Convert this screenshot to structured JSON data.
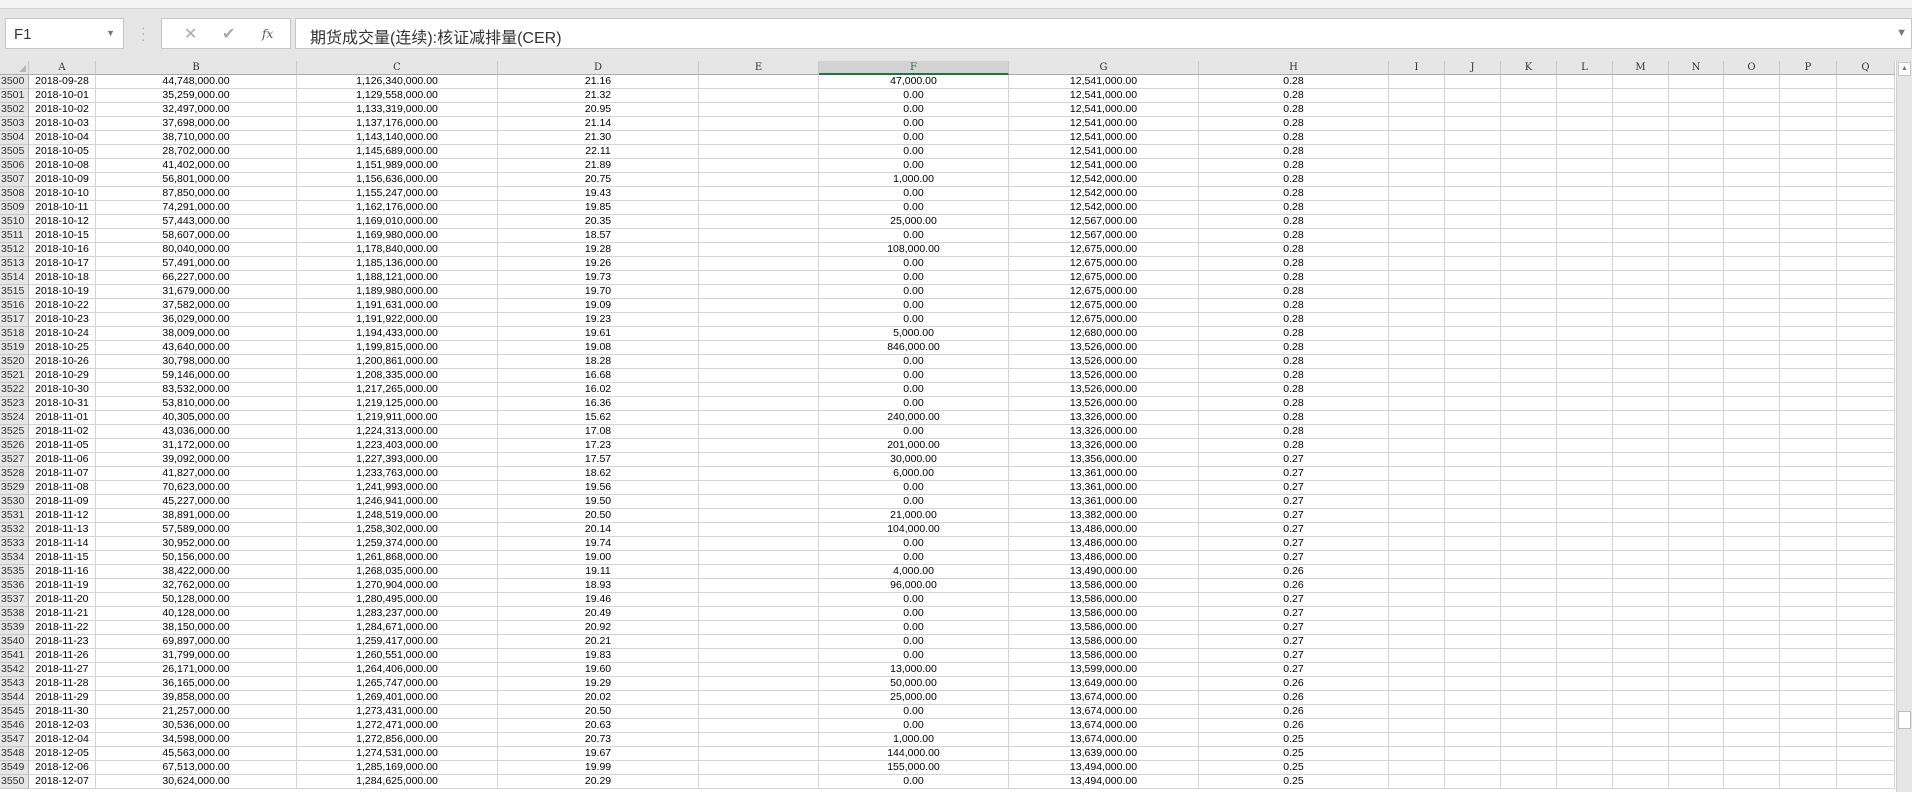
{
  "name_box": {
    "value": "F1"
  },
  "formula_bar": {
    "cancel": "✕",
    "enter": "✔",
    "fx": "fx",
    "value": "期货成交量(连续):核证减排量(CER)"
  },
  "selected_column": "F",
  "columns": [
    "A",
    "B",
    "C",
    "D",
    "E",
    "F",
    "G",
    "H",
    "I",
    "J",
    "K",
    "L",
    "M",
    "N",
    "O",
    "P",
    "Q"
  ],
  "rows": [
    [
      "3500",
      "2018-09-28",
      "44,748,000.00",
      "1,126,340,000.00",
      "21.16",
      "",
      "47,000.00",
      "12,541,000.00",
      "0.28"
    ],
    [
      "3501",
      "2018-10-01",
      "35,259,000.00",
      "1,129,558,000.00",
      "21.32",
      "",
      "0.00",
      "12,541,000.00",
      "0.28"
    ],
    [
      "3502",
      "2018-10-02",
      "32,497,000.00",
      "1,133,319,000.00",
      "20.95",
      "",
      "0.00",
      "12,541,000.00",
      "0.28"
    ],
    [
      "3503",
      "2018-10-03",
      "37,698,000.00",
      "1,137,176,000.00",
      "21.14",
      "",
      "0.00",
      "12,541,000.00",
      "0.28"
    ],
    [
      "3504",
      "2018-10-04",
      "38,710,000.00",
      "1,143,140,000.00",
      "21.30",
      "",
      "0.00",
      "12,541,000.00",
      "0.28"
    ],
    [
      "3505",
      "2018-10-05",
      "28,702,000.00",
      "1,145,689,000.00",
      "22.11",
      "",
      "0.00",
      "12,541,000.00",
      "0.28"
    ],
    [
      "3506",
      "2018-10-08",
      "41,402,000.00",
      "1,151,989,000.00",
      "21.89",
      "",
      "0.00",
      "12,541,000.00",
      "0.28"
    ],
    [
      "3507",
      "2018-10-09",
      "56,801,000.00",
      "1,156,636,000.00",
      "20.75",
      "",
      "1,000.00",
      "12,542,000.00",
      "0.28"
    ],
    [
      "3508",
      "2018-10-10",
      "87,850,000.00",
      "1,155,247,000.00",
      "19.43",
      "",
      "0.00",
      "12,542,000.00",
      "0.28"
    ],
    [
      "3509",
      "2018-10-11",
      "74,291,000.00",
      "1,162,176,000.00",
      "19.85",
      "",
      "0.00",
      "12,542,000.00",
      "0.28"
    ],
    [
      "3510",
      "2018-10-12",
      "57,443,000.00",
      "1,169,010,000.00",
      "20.35",
      "",
      "25,000.00",
      "12,567,000.00",
      "0.28"
    ],
    [
      "3511",
      "2018-10-15",
      "58,607,000.00",
      "1,169,980,000.00",
      "18.57",
      "",
      "0.00",
      "12,567,000.00",
      "0.28"
    ],
    [
      "3512",
      "2018-10-16",
      "80,040,000.00",
      "1,178,840,000.00",
      "19.28",
      "",
      "108,000.00",
      "12,675,000.00",
      "0.28"
    ],
    [
      "3513",
      "2018-10-17",
      "57,491,000.00",
      "1,185,136,000.00",
      "19.26",
      "",
      "0.00",
      "12,675,000.00",
      "0.28"
    ],
    [
      "3514",
      "2018-10-18",
      "66,227,000.00",
      "1,188,121,000.00",
      "19.73",
      "",
      "0.00",
      "12,675,000.00",
      "0.28"
    ],
    [
      "3515",
      "2018-10-19",
      "31,679,000.00",
      "1,189,980,000.00",
      "19.70",
      "",
      "0.00",
      "12,675,000.00",
      "0.28"
    ],
    [
      "3516",
      "2018-10-22",
      "37,582,000.00",
      "1,191,631,000.00",
      "19.09",
      "",
      "0.00",
      "12,675,000.00",
      "0.28"
    ],
    [
      "3517",
      "2018-10-23",
      "36,029,000.00",
      "1,191,922,000.00",
      "19.23",
      "",
      "0.00",
      "12,675,000.00",
      "0.28"
    ],
    [
      "3518",
      "2018-10-24",
      "38,009,000.00",
      "1,194,433,000.00",
      "19.61",
      "",
      "5,000.00",
      "12,680,000.00",
      "0.28"
    ],
    [
      "3519",
      "2018-10-25",
      "43,640,000.00",
      "1,199,815,000.00",
      "19.08",
      "",
      "846,000.00",
      "13,526,000.00",
      "0.28"
    ],
    [
      "3520",
      "2018-10-26",
      "30,798,000.00",
      "1,200,861,000.00",
      "18.28",
      "",
      "0.00",
      "13,526,000.00",
      "0.28"
    ],
    [
      "3521",
      "2018-10-29",
      "59,146,000.00",
      "1,208,335,000.00",
      "16.68",
      "",
      "0.00",
      "13,526,000.00",
      "0.28"
    ],
    [
      "3522",
      "2018-10-30",
      "83,532,000.00",
      "1,217,265,000.00",
      "16.02",
      "",
      "0.00",
      "13,526,000.00",
      "0.28"
    ],
    [
      "3523",
      "2018-10-31",
      "53,810,000.00",
      "1,219,125,000.00",
      "16.36",
      "",
      "0.00",
      "13,526,000.00",
      "0.28"
    ],
    [
      "3524",
      "2018-11-01",
      "40,305,000.00",
      "1,219,911,000.00",
      "15.62",
      "",
      "240,000.00",
      "13,326,000.00",
      "0.28"
    ],
    [
      "3525",
      "2018-11-02",
      "43,036,000.00",
      "1,224,313,000.00",
      "17.08",
      "",
      "0.00",
      "13,326,000.00",
      "0.28"
    ],
    [
      "3526",
      "2018-11-05",
      "31,172,000.00",
      "1,223,403,000.00",
      "17.23",
      "",
      "201,000.00",
      "13,326,000.00",
      "0.28"
    ],
    [
      "3527",
      "2018-11-06",
      "39,092,000.00",
      "1,227,393,000.00",
      "17.57",
      "",
      "30,000.00",
      "13,356,000.00",
      "0.27"
    ],
    [
      "3528",
      "2018-11-07",
      "41,827,000.00",
      "1,233,763,000.00",
      "18.62",
      "",
      "6,000.00",
      "13,361,000.00",
      "0.27"
    ],
    [
      "3529",
      "2018-11-08",
      "70,623,000.00",
      "1,241,993,000.00",
      "19.56",
      "",
      "0.00",
      "13,361,000.00",
      "0.27"
    ],
    [
      "3530",
      "2018-11-09",
      "45,227,000.00",
      "1,246,941,000.00",
      "19.50",
      "",
      "0.00",
      "13,361,000.00",
      "0.27"
    ],
    [
      "3531",
      "2018-11-12",
      "38,891,000.00",
      "1,248,519,000.00",
      "20.50",
      "",
      "21,000.00",
      "13,382,000.00",
      "0.27"
    ],
    [
      "3532",
      "2018-11-13",
      "57,589,000.00",
      "1,258,302,000.00",
      "20.14",
      "",
      "104,000.00",
      "13,486,000.00",
      "0.27"
    ],
    [
      "3533",
      "2018-11-14",
      "30,952,000.00",
      "1,259,374,000.00",
      "19.74",
      "",
      "0.00",
      "13,486,000.00",
      "0.27"
    ],
    [
      "3534",
      "2018-11-15",
      "50,156,000.00",
      "1,261,868,000.00",
      "19.00",
      "",
      "0.00",
      "13,486,000.00",
      "0.27"
    ],
    [
      "3535",
      "2018-11-16",
      "38,422,000.00",
      "1,268,035,000.00",
      "19.11",
      "",
      "4,000.00",
      "13,490,000.00",
      "0.26"
    ],
    [
      "3536",
      "2018-11-19",
      "32,762,000.00",
      "1,270,904,000.00",
      "18.93",
      "",
      "96,000.00",
      "13,586,000.00",
      "0.26"
    ],
    [
      "3537",
      "2018-11-20",
      "50,128,000.00",
      "1,280,495,000.00",
      "19.46",
      "",
      "0.00",
      "13,586,000.00",
      "0.27"
    ],
    [
      "3538",
      "2018-11-21",
      "40,128,000.00",
      "1,283,237,000.00",
      "20.49",
      "",
      "0.00",
      "13,586,000.00",
      "0.27"
    ],
    [
      "3539",
      "2018-11-22",
      "38,150,000.00",
      "1,284,671,000.00",
      "20.92",
      "",
      "0.00",
      "13,586,000.00",
      "0.27"
    ],
    [
      "3540",
      "2018-11-23",
      "69,897,000.00",
      "1,259,417,000.00",
      "20.21",
      "",
      "0.00",
      "13,586,000.00",
      "0.27"
    ],
    [
      "3541",
      "2018-11-26",
      "31,799,000.00",
      "1,260,551,000.00",
      "19.83",
      "",
      "0.00",
      "13,586,000.00",
      "0.27"
    ],
    [
      "3542",
      "2018-11-27",
      "26,171,000.00",
      "1,264,406,000.00",
      "19.60",
      "",
      "13,000.00",
      "13,599,000.00",
      "0.27"
    ],
    [
      "3543",
      "2018-11-28",
      "36,165,000.00",
      "1,265,747,000.00",
      "19.29",
      "",
      "50,000.00",
      "13,649,000.00",
      "0.26"
    ],
    [
      "3544",
      "2018-11-29",
      "39,858,000.00",
      "1,269,401,000.00",
      "20.02",
      "",
      "25,000.00",
      "13,674,000.00",
      "0.26"
    ],
    [
      "3545",
      "2018-11-30",
      "21,257,000.00",
      "1,273,431,000.00",
      "20.50",
      "",
      "0.00",
      "13,674,000.00",
      "0.26"
    ],
    [
      "3546",
      "2018-12-03",
      "30,536,000.00",
      "1,272,471,000.00",
      "20.63",
      "",
      "0.00",
      "13,674,000.00",
      "0.26"
    ],
    [
      "3547",
      "2018-12-04",
      "34,598,000.00",
      "1,272,856,000.00",
      "20.73",
      "",
      "1,000.00",
      "13,674,000.00",
      "0.25"
    ],
    [
      "3548",
      "2018-12-05",
      "45,563,000.00",
      "1,274,531,000.00",
      "19.67",
      "",
      "144,000.00",
      "13,639,000.00",
      "0.25"
    ],
    [
      "3549",
      "2018-12-06",
      "67,513,000.00",
      "1,285,169,000.00",
      "19.99",
      "",
      "155,000.00",
      "13,494,000.00",
      "0.25"
    ],
    [
      "3550",
      "2018-12-07",
      "30,624,000.00",
      "1,284,625,000.00",
      "20.29",
      "",
      "0.00",
      "13,494,000.00",
      "0.25"
    ]
  ]
}
